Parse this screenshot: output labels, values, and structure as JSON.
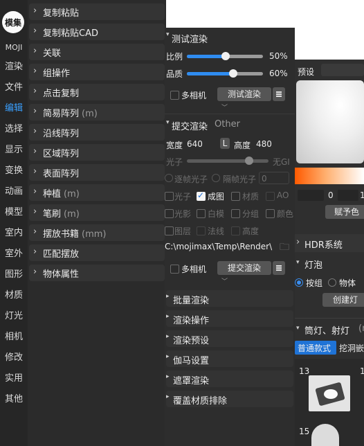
{
  "leftnav": {
    "logo": "模集",
    "items": [
      "MOJI",
      "渲染",
      "文件",
      "编辑",
      "选择",
      "显示",
      "变换",
      "动画",
      "模型",
      "室内",
      "室外",
      "图形",
      "材质",
      "灯光",
      "相机",
      "修改",
      "实用",
      "其他"
    ],
    "active": "编辑"
  },
  "menu": [
    {
      "label": "复制粘贴",
      "sub": ""
    },
    {
      "label": "复制粘贴CAD",
      "sub": ""
    },
    {
      "label": "关联",
      "sub": ""
    },
    {
      "label": "组操作",
      "sub": ""
    },
    {
      "label": "点击复制",
      "sub": ""
    },
    {
      "label": "简易阵列",
      "sub": "(m)"
    },
    {
      "label": "沿线阵列",
      "sub": ""
    },
    {
      "label": "区域阵列",
      "sub": ""
    },
    {
      "label": "表面阵列",
      "sub": ""
    },
    {
      "label": "种植",
      "sub": "(m)"
    },
    {
      "label": "笔刷",
      "sub": "(m)"
    },
    {
      "label": "摆放书籍",
      "sub": "(mm)"
    },
    {
      "label": "匹配摆放",
      "sub": ""
    },
    {
      "label": "物体属性",
      "sub": ""
    }
  ],
  "test_render": {
    "title": "测试渲染",
    "ratio_label": "比例",
    "ratio_value": "50%",
    "ratio_fraction": 0.5,
    "quality_label": "品质",
    "quality_value": "60%",
    "quality_fraction": 0.6,
    "multicam_label": "多相机",
    "button": "测试渲染"
  },
  "submit_render": {
    "title": "提交渲染",
    "title_extra": "Other",
    "width_label": "宽度",
    "width_value": "640",
    "lock_label": "L",
    "height_label": "高度",
    "height_value": "480",
    "photon_label": "光子",
    "no_gi_label": "无GI",
    "per_frame_photon": "逐帧光子",
    "interval_photon": "隔帧光子",
    "interval_value": "0",
    "options_row1": [
      "光子",
      "成图",
      "材质",
      "AO"
    ],
    "options_row2": [
      "光影",
      "白模",
      "分组",
      "颜色"
    ],
    "options_row3": [
      "图层",
      "法线",
      "高度"
    ],
    "path": "C:\\mojimax\\Temp\\Render\\",
    "multicam_label": "多相机",
    "button": "提交渲染"
  },
  "sections": [
    "批量渲染",
    "渲染操作",
    "渲染预设",
    "伽马设置",
    "遮罩渲染",
    "覆盖材质排除"
  ],
  "right": {
    "preset_label": "预设",
    "value_left": "0",
    "value_right": "1",
    "assign_button": "赋予色",
    "hdr_title": "HDR系统",
    "bulb_title": "灯泡",
    "radio_group": "按组",
    "radio_object": "物体",
    "create_button": "创建灯",
    "spot_title": "筒灯、射灯",
    "spot_suffix": "(m",
    "tab_normal": "普通款式",
    "tab_cut": "挖洞嵌",
    "thumb1": "13",
    "thumb2": "1",
    "thumb3": "15"
  },
  "colors": {
    "accent": "#2f8cf0",
    "gradient_start": "#ff5a00",
    "gradient_end": "#ffffff"
  }
}
